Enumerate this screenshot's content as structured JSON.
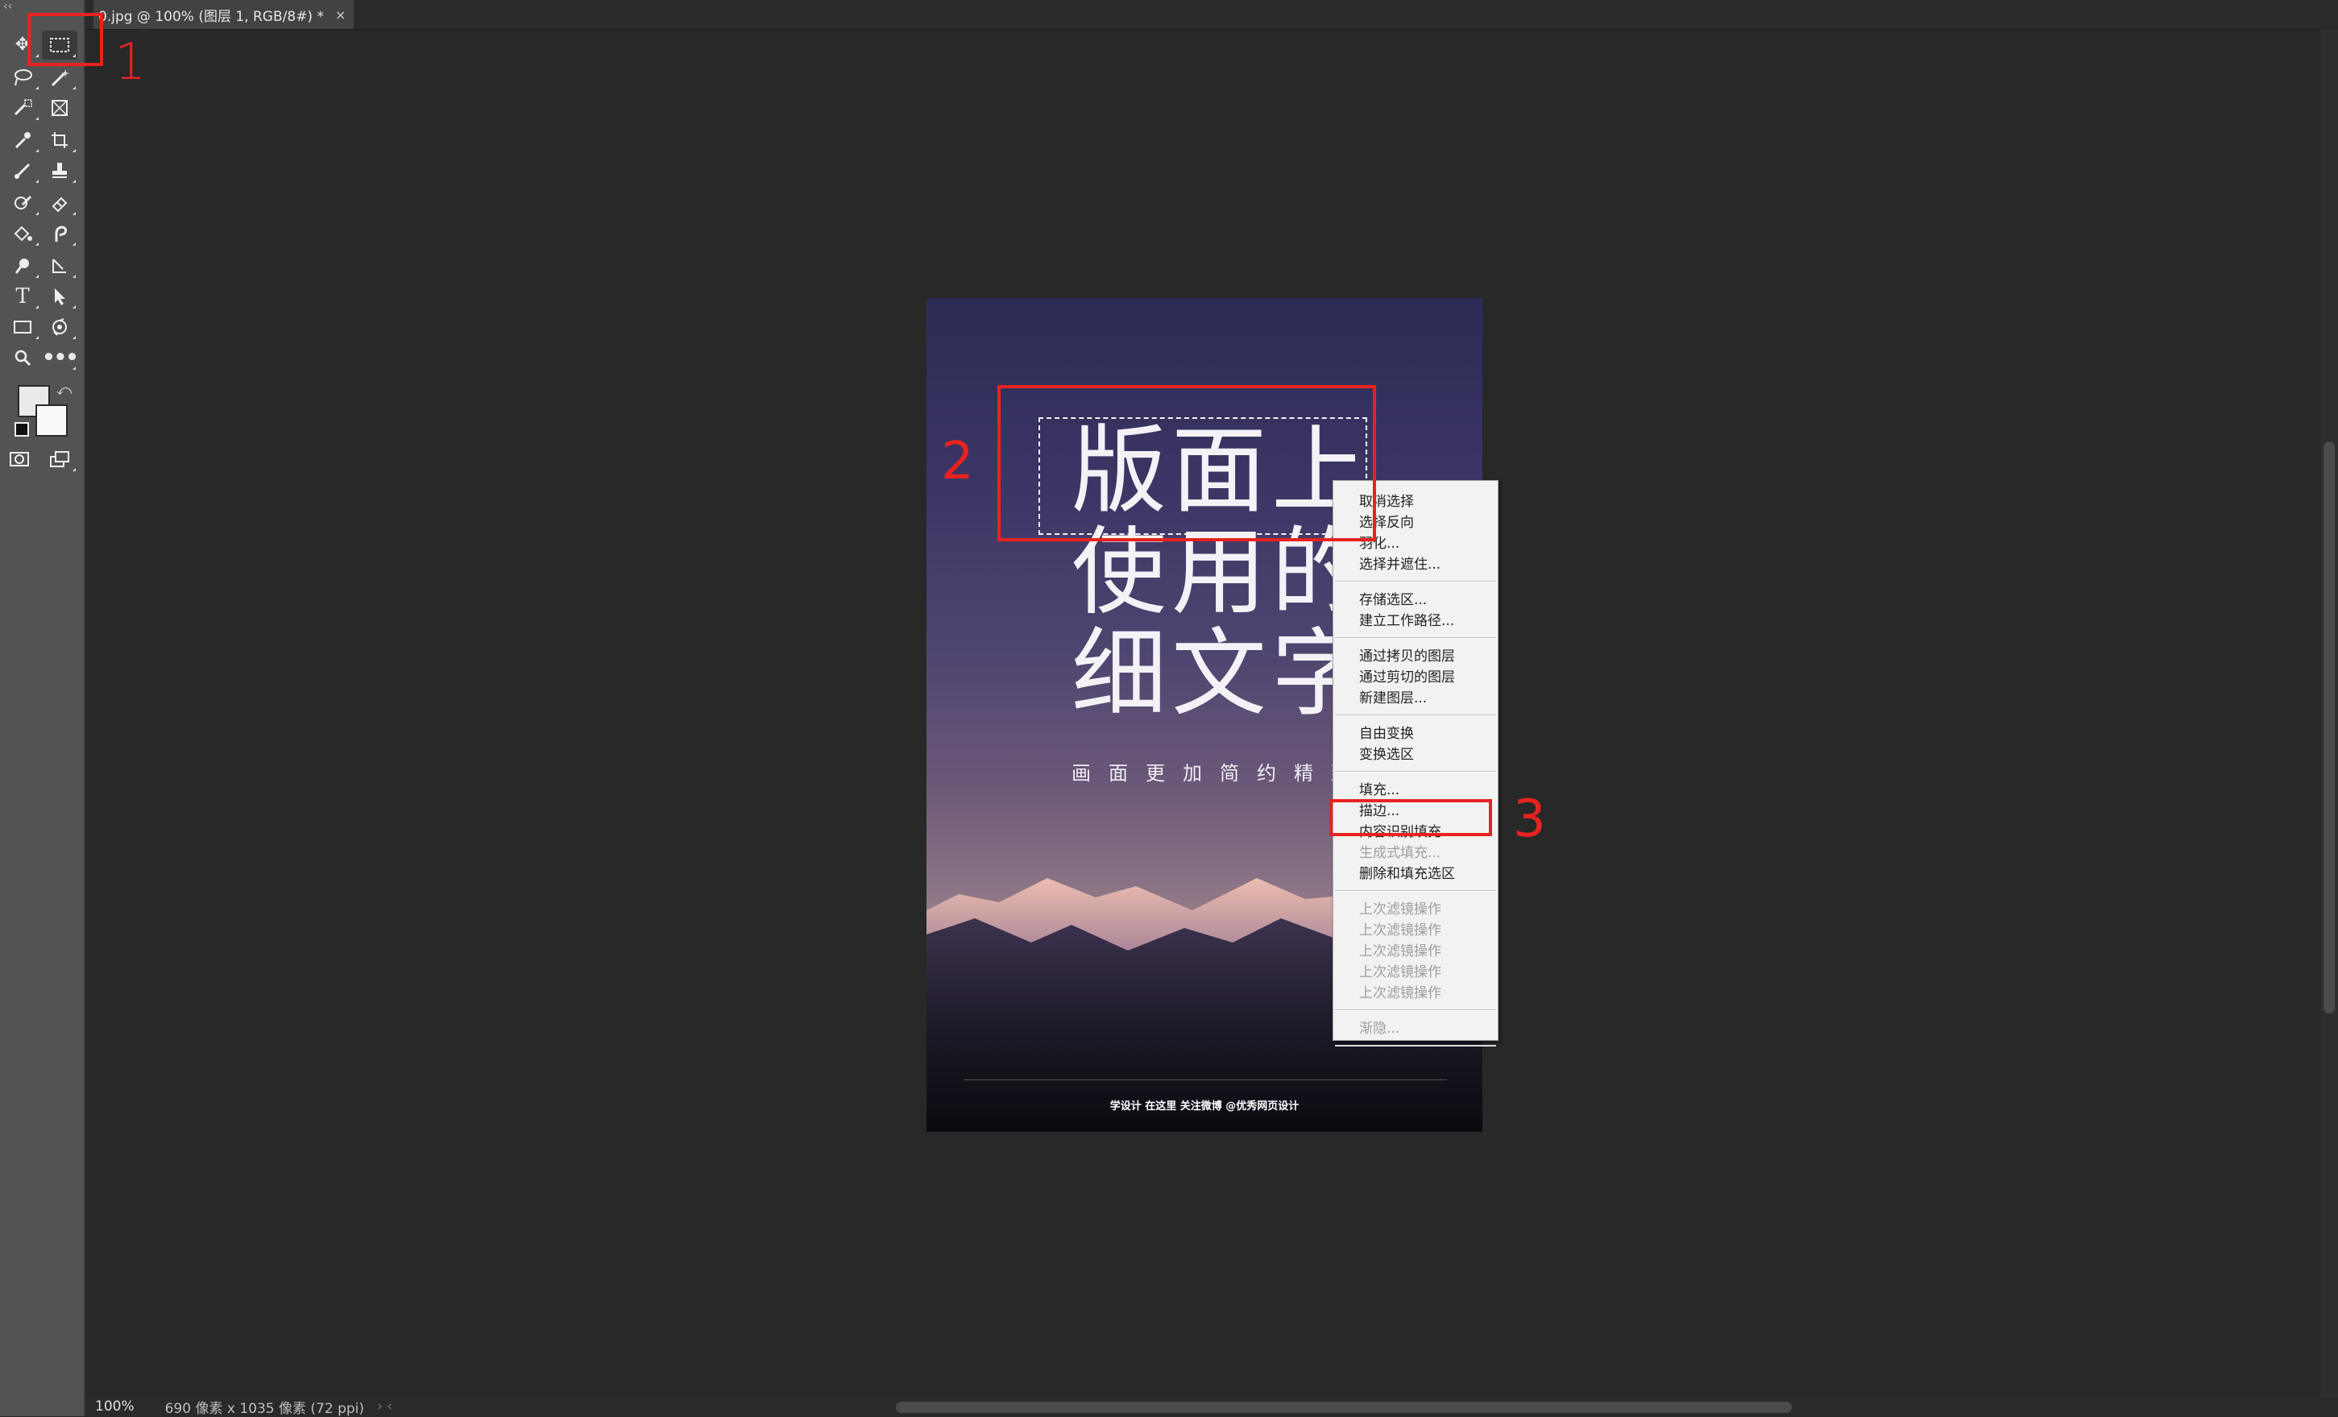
{
  "document": {
    "tab_title": "0.jpg @ 100% (图层 1, RGB/8#) *",
    "close_symbol": "×"
  },
  "toolbar": {
    "collapse_glyph": "‹‹",
    "tools": [
      "move-tool",
      "rectangular-marquee-tool",
      "lasso-tool",
      "magic-wand-tool",
      "object-selection-tool",
      "frame-tool",
      "eyedropper-tool",
      "crop-tool",
      "brush-tool",
      "clone-stamp-tool",
      "history-brush-tool",
      "eraser-tool",
      "paint-bucket-tool",
      "smudge-tool",
      "dodge-tool",
      "pen-tool",
      "type-tool",
      "path-selection-tool",
      "rectangle-tool",
      "rotate-view-tool",
      "zoom-tool",
      "more-tools"
    ],
    "foreground_color": "#eaeaea",
    "background_color": "#fafafa"
  },
  "poster": {
    "headline": [
      "版面上",
      "使用的",
      "细文字"
    ],
    "subtitle": "画面更加简约精致",
    "footer": "学设计 在这里    关注微博 @优秀网页设计"
  },
  "context_menu": {
    "groups": [
      [
        {
          "label": "取消选择",
          "enabled": true
        },
        {
          "label": "选择反向",
          "enabled": true
        },
        {
          "label": "羽化...",
          "enabled": true
        },
        {
          "label": "选择并遮住...",
          "enabled": true
        }
      ],
      [
        {
          "label": "存储选区...",
          "enabled": true
        },
        {
          "label": "建立工作路径...",
          "enabled": true
        }
      ],
      [
        {
          "label": "通过拷贝的图层",
          "enabled": true
        },
        {
          "label": "通过剪切的图层",
          "enabled": true
        },
        {
          "label": "新建图层...",
          "enabled": true
        }
      ],
      [
        {
          "label": "自由变换",
          "enabled": true
        },
        {
          "label": "变换选区",
          "enabled": true
        }
      ],
      [
        {
          "label": "填充...",
          "enabled": true
        },
        {
          "label": "描边...",
          "enabled": true
        },
        {
          "label": "内容识别填充...",
          "enabled": true
        },
        {
          "label": "生成式填充...",
          "enabled": false
        },
        {
          "label": "删除和填充选区",
          "enabled": true
        }
      ],
      [
        {
          "label": "上次滤镜操作",
          "enabled": false
        },
        {
          "label": "上次滤镜操作",
          "enabled": false
        },
        {
          "label": "上次滤镜操作",
          "enabled": false
        },
        {
          "label": "上次滤镜操作",
          "enabled": false
        },
        {
          "label": "上次滤镜操作",
          "enabled": false
        }
      ],
      [
        {
          "label": "渐隐...",
          "enabled": false
        }
      ]
    ]
  },
  "annotations": {
    "step1": "1",
    "step2": "2",
    "step3": "3",
    "color": "#e8231f"
  },
  "status_bar": {
    "zoom": "100%",
    "doc_info": "690 像素 x 1035 像素 (72 ppi)",
    "arrows": "›  ‹"
  }
}
